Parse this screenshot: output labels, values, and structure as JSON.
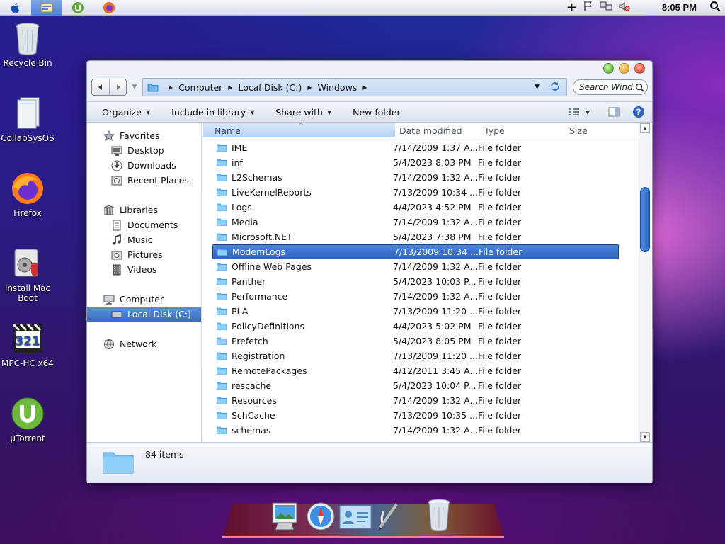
{
  "menubar": {
    "clock": "8:05 PM",
    "items": [
      "apple-logo-icon",
      "explorer-icon",
      "utorrent-icon",
      "firefox-icon"
    ]
  },
  "desktop": {
    "icons": [
      {
        "label": "Recycle Bin",
        "icon": "recycle-bin-icon"
      },
      {
        "label": "CollabSysOS",
        "icon": "documents-icon"
      },
      {
        "label": "Firefox",
        "icon": "firefox-icon"
      },
      {
        "label": "Install Mac Boot",
        "icon": "installer-icon"
      },
      {
        "label": "MPC-HC x64",
        "icon": "mpc-hc-icon"
      },
      {
        "label": "µTorrent",
        "icon": "utorrent-icon"
      }
    ]
  },
  "window": {
    "address": {
      "crumbs": [
        "Computer",
        "Local Disk (C:)",
        "Windows"
      ]
    },
    "search": {
      "placeholder": "Search Wind..."
    },
    "toolbar": {
      "organize": "Organize",
      "include_in_library": "Include in library",
      "share_with": "Share with",
      "new_folder": "New folder"
    },
    "nav": {
      "favorites": "Favorites",
      "desktop": "Desktop",
      "downloads": "Downloads",
      "recent_places": "Recent Places",
      "libraries": "Libraries",
      "documents": "Documents",
      "music": "Music",
      "pictures": "Pictures",
      "videos": "Videos",
      "computer": "Computer",
      "local_disk": "Local Disk (C:)",
      "network": "Network"
    },
    "columns": {
      "name": "Name",
      "date_modified": "Date modified",
      "type": "Type",
      "size": "Size"
    },
    "files": [
      {
        "name": "IME",
        "date": "7/14/2009 1:37 A...",
        "type": "File folder"
      },
      {
        "name": "inf",
        "date": "5/4/2023 8:03 PM",
        "type": "File folder"
      },
      {
        "name": "L2Schemas",
        "date": "7/14/2009 1:32 A...",
        "type": "File folder"
      },
      {
        "name": "LiveKernelReports",
        "date": "7/13/2009 10:34 ...",
        "type": "File folder"
      },
      {
        "name": "Logs",
        "date": "4/4/2023 4:52 PM",
        "type": "File folder"
      },
      {
        "name": "Media",
        "date": "7/14/2009 1:32 A...",
        "type": "File folder"
      },
      {
        "name": "Microsoft.NET",
        "date": "5/4/2023 7:38 PM",
        "type": "File folder"
      },
      {
        "name": "ModemLogs",
        "date": "7/13/2009 10:34 ...",
        "type": "File folder",
        "selected": true
      },
      {
        "name": "Offline Web Pages",
        "date": "7/14/2009 1:32 A...",
        "type": "File folder"
      },
      {
        "name": "Panther",
        "date": "5/4/2023 10:03 P...",
        "type": "File folder"
      },
      {
        "name": "Performance",
        "date": "7/14/2009 1:32 A...",
        "type": "File folder"
      },
      {
        "name": "PLA",
        "date": "7/13/2009 11:20 ...",
        "type": "File folder"
      },
      {
        "name": "PolicyDefinitions",
        "date": "4/4/2023 5:02 PM",
        "type": "File folder"
      },
      {
        "name": "Prefetch",
        "date": "5/4/2023 8:05 PM",
        "type": "File folder"
      },
      {
        "name": "Registration",
        "date": "7/13/2009 11:20 ...",
        "type": "File folder"
      },
      {
        "name": "RemotePackages",
        "date": "4/12/2011 3:45 A...",
        "type": "File folder"
      },
      {
        "name": "rescache",
        "date": "5/4/2023 10:04 P...",
        "type": "File folder"
      },
      {
        "name": "Resources",
        "date": "7/14/2009 1:32 A...",
        "type": "File folder"
      },
      {
        "name": "SchCache",
        "date": "7/13/2009 10:35 ...",
        "type": "File folder"
      },
      {
        "name": "schemas",
        "date": "7/14/2009 1:32 A...",
        "type": "File folder"
      }
    ],
    "details": {
      "count": "84 items"
    }
  },
  "dock": {
    "items": [
      "photo-viewer-icon",
      "safari-icon",
      "contacts-icon",
      "pen-tool-icon",
      "dock-trash-icon"
    ]
  },
  "colors": {
    "selection": "#3a6fc4",
    "folder": "#5fb4f2",
    "desktop_bg": "#2b1b7c"
  }
}
